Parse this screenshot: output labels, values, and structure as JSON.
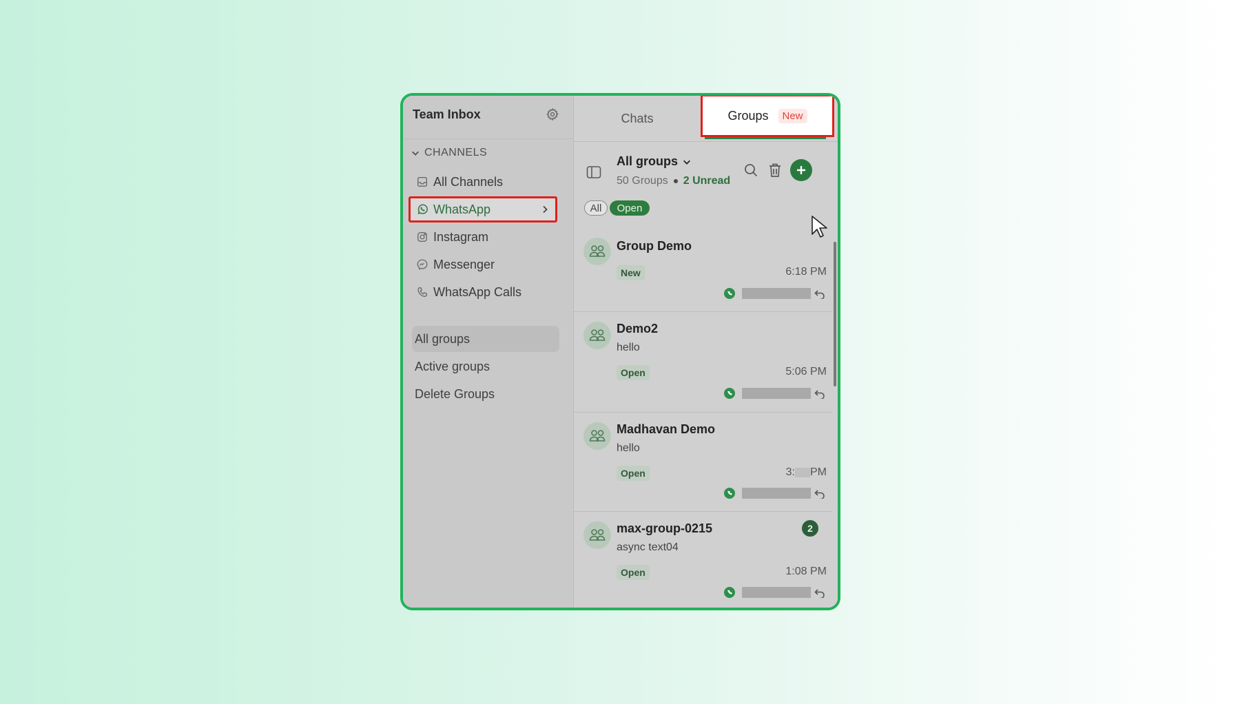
{
  "sidebar": {
    "title": "Team Inbox",
    "channels_heading": "CHANNELS",
    "channels": [
      {
        "label": "All Channels",
        "icon": "inbox-icon"
      },
      {
        "label": "WhatsApp",
        "icon": "whatsapp-icon"
      },
      {
        "label": "Instagram",
        "icon": "instagram-icon"
      },
      {
        "label": "Messenger",
        "icon": "messenger-icon"
      },
      {
        "label": "WhatsApp Calls",
        "icon": "phone-icon"
      }
    ],
    "groups_nav": [
      {
        "label": "All groups",
        "active": true
      },
      {
        "label": "Active groups"
      },
      {
        "label": "Delete Groups"
      }
    ]
  },
  "tabs": {
    "chats": "Chats",
    "groups": "Groups",
    "groups_badge": "New"
  },
  "list_header": {
    "filter_label": "All groups",
    "count_text": "50 Groups",
    "unread_text": "2 Unread",
    "chip_all": "All",
    "chip_open": "Open"
  },
  "groups": [
    {
      "name": "Group Demo",
      "preview": "",
      "status": "New",
      "time": "6:18 PM",
      "unread": ""
    },
    {
      "name": "Demo2",
      "preview": "hello",
      "status": "Open",
      "time": "5:06 PM",
      "unread": ""
    },
    {
      "name": "Madhavan Demo",
      "preview": "hello",
      "status": "Open",
      "time_prefix": "3:",
      "time_suffix": "PM",
      "unread": ""
    },
    {
      "name": "max-group-0215",
      "preview": "async text04",
      "status": "Open",
      "time": "1:08 PM",
      "unread": "2"
    }
  ],
  "colors": {
    "frame_border": "#22b25c",
    "highlight_red": "#e0201c",
    "accent_green": "#2e7d3e"
  }
}
